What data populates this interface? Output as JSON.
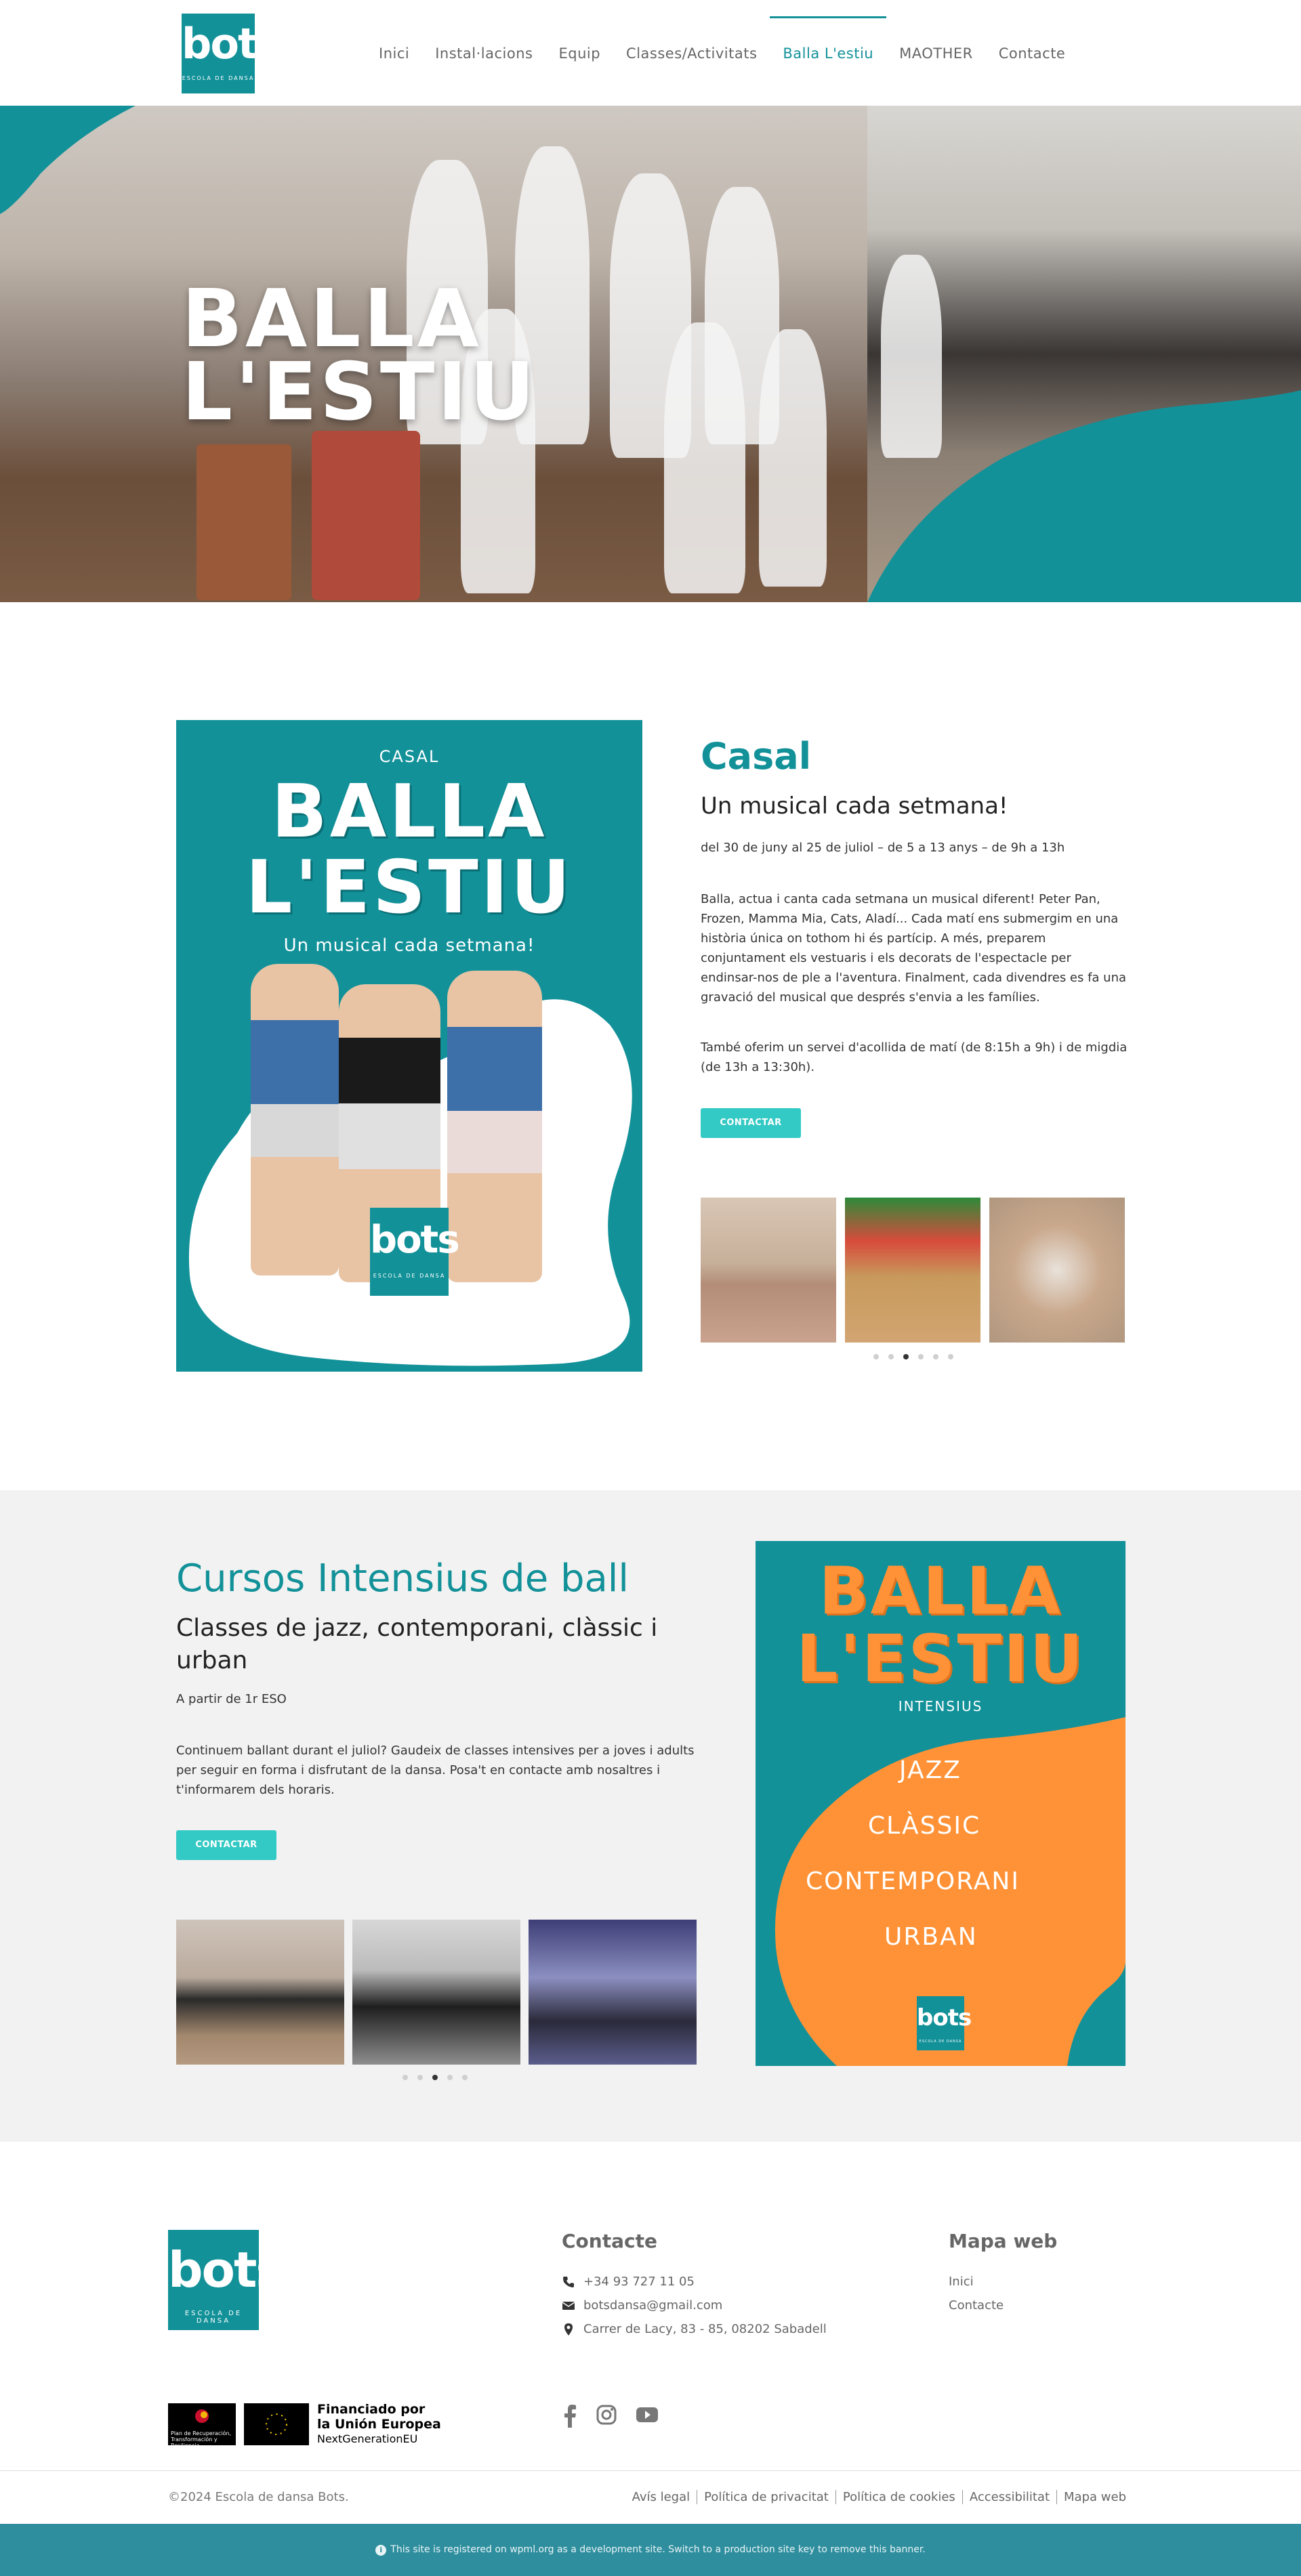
{
  "header": {
    "logo": {
      "word": "bots",
      "sub": "ESCOLA DE DANSA"
    },
    "nav": [
      {
        "label": "Inici"
      },
      {
        "label": "Instal·lacions"
      },
      {
        "label": "Equip"
      },
      {
        "label": "Classes/Activitats"
      },
      {
        "label": "Balla L'estiu"
      },
      {
        "label": "MAOTHER"
      },
      {
        "label": "Contacte"
      }
    ],
    "active_index": 4
  },
  "hero": {
    "title_line1": "BALLA",
    "title_line2": "L'ESTIU"
  },
  "casal": {
    "poster": {
      "top": "CASAL",
      "big1": "BALLA",
      "big2": "L'ESTIU",
      "sub": "Un musical cada setmana!",
      "logo_word": "bots",
      "logo_sub": "ESCOLA DE DANSA"
    },
    "title": "Casal",
    "subtitle": "Un musical cada setmana!",
    "dates": "del 30 de juny al 25 de juliol – de 5 a 13 anys – de 9h a 13h",
    "description": "Balla, actua i canta cada setmana un musical diferent! Peter Pan, Frozen, Mamma Mia, Cats, Aladí... Cada matí ens submergim en una història única on tothom hi és partícip. A més, preparem conjuntament els vestuaris i els decorats de l'espectacle per endinsar-nos de ple a l'aventura. Finalment, cada divendres es fa una gravació del musical que després s'envia a les famílies.",
    "description2": "També oferim un servei d'acollida de matí (de 8:15h a 9h) i de migdia (de 13h a 13:30h).",
    "button": "CONTACTAR",
    "carousel_dots": 6,
    "carousel_active": 2
  },
  "intensius": {
    "title": "Cursos Intensius de ball",
    "subtitle": "Classes de jazz, contemporani, clàssic i urban",
    "age": "A partir de 1r ESO",
    "description": "Continuem ballant durant el juliol? Gaudeix de classes intensives per a joves i adults per seguir en forma i disfrutant de la dansa. Posa't en contacte amb nosaltres i t'informarem dels horaris.",
    "button": "CONTACTAR",
    "carousel_dots": 5,
    "carousel_active": 2,
    "poster": {
      "big1": "BALLA",
      "big2": "L'ESTIU",
      "small": "INTENSIUS",
      "items": [
        "JAZZ",
        "CLÀSSIC",
        "CONTEMPORANI",
        "URBAN"
      ],
      "logo_word": "bots",
      "logo_sub": "ESCOLA DE DANSA"
    }
  },
  "footer": {
    "logo": {
      "word": "bots",
      "sub": "ESCOLA DE DANSA"
    },
    "contact_heading": "Contacte",
    "phone": "+34 93 727 11 05",
    "email": "botsdansa@gmail.com",
    "address": "Carrer de Lacy, 83 - 85, 08202 Sabadell",
    "sitemap_heading": "Mapa web",
    "sitemap": [
      "Inici",
      "Contacte"
    ],
    "eu": {
      "box1": "Plan de Recuperación, Transformación y Resiliencia",
      "line1": "Financiado por",
      "line2": "la Unión Europea",
      "line3": "NextGenerationEU"
    },
    "copyright": "©2024 Escola de dansa Bots.",
    "legal": [
      "Avís legal",
      "Política de privacitat",
      "Política de cookies",
      "Accessibilitat",
      "Mapa web"
    ],
    "dev_banner": "This site is registered on wpml.org as a development site. Switch to a production site key to remove this banner."
  },
  "colors": {
    "teal": "#129199",
    "button": "#33c9c4",
    "orange": "#ff9236",
    "banner": "#2f8e9e"
  }
}
